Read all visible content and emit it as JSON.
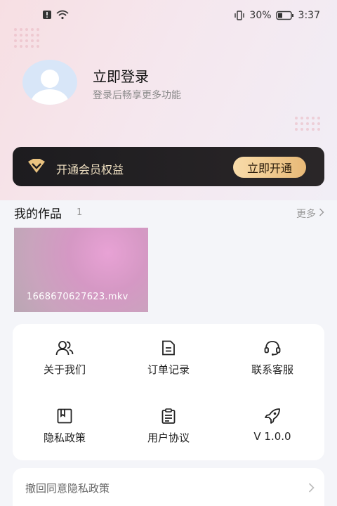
{
  "status_bar": {
    "battery_percent": "30%",
    "time": "3:37"
  },
  "profile": {
    "login_title": "立即登录",
    "login_subtitle": "登录后畅享更多功能"
  },
  "vip": {
    "label": "开通会员权益",
    "button": "立即开通"
  },
  "works": {
    "title": "我的作品",
    "count": "1",
    "more": "更多",
    "items": [
      {
        "name": "1668670627623.mkv"
      }
    ]
  },
  "menu": {
    "items": [
      {
        "label": "关于我们",
        "icon": "users-icon"
      },
      {
        "label": "订单记录",
        "icon": "document-icon"
      },
      {
        "label": "联系客服",
        "icon": "headset-icon"
      },
      {
        "label": "隐私政策",
        "icon": "book-icon"
      },
      {
        "label": "用户协议",
        "icon": "clipboard-icon"
      },
      {
        "label": "V 1.0.0",
        "icon": "rocket-icon"
      }
    ]
  },
  "privacy_revoke": {
    "label": "撤回同意隐私政策"
  }
}
